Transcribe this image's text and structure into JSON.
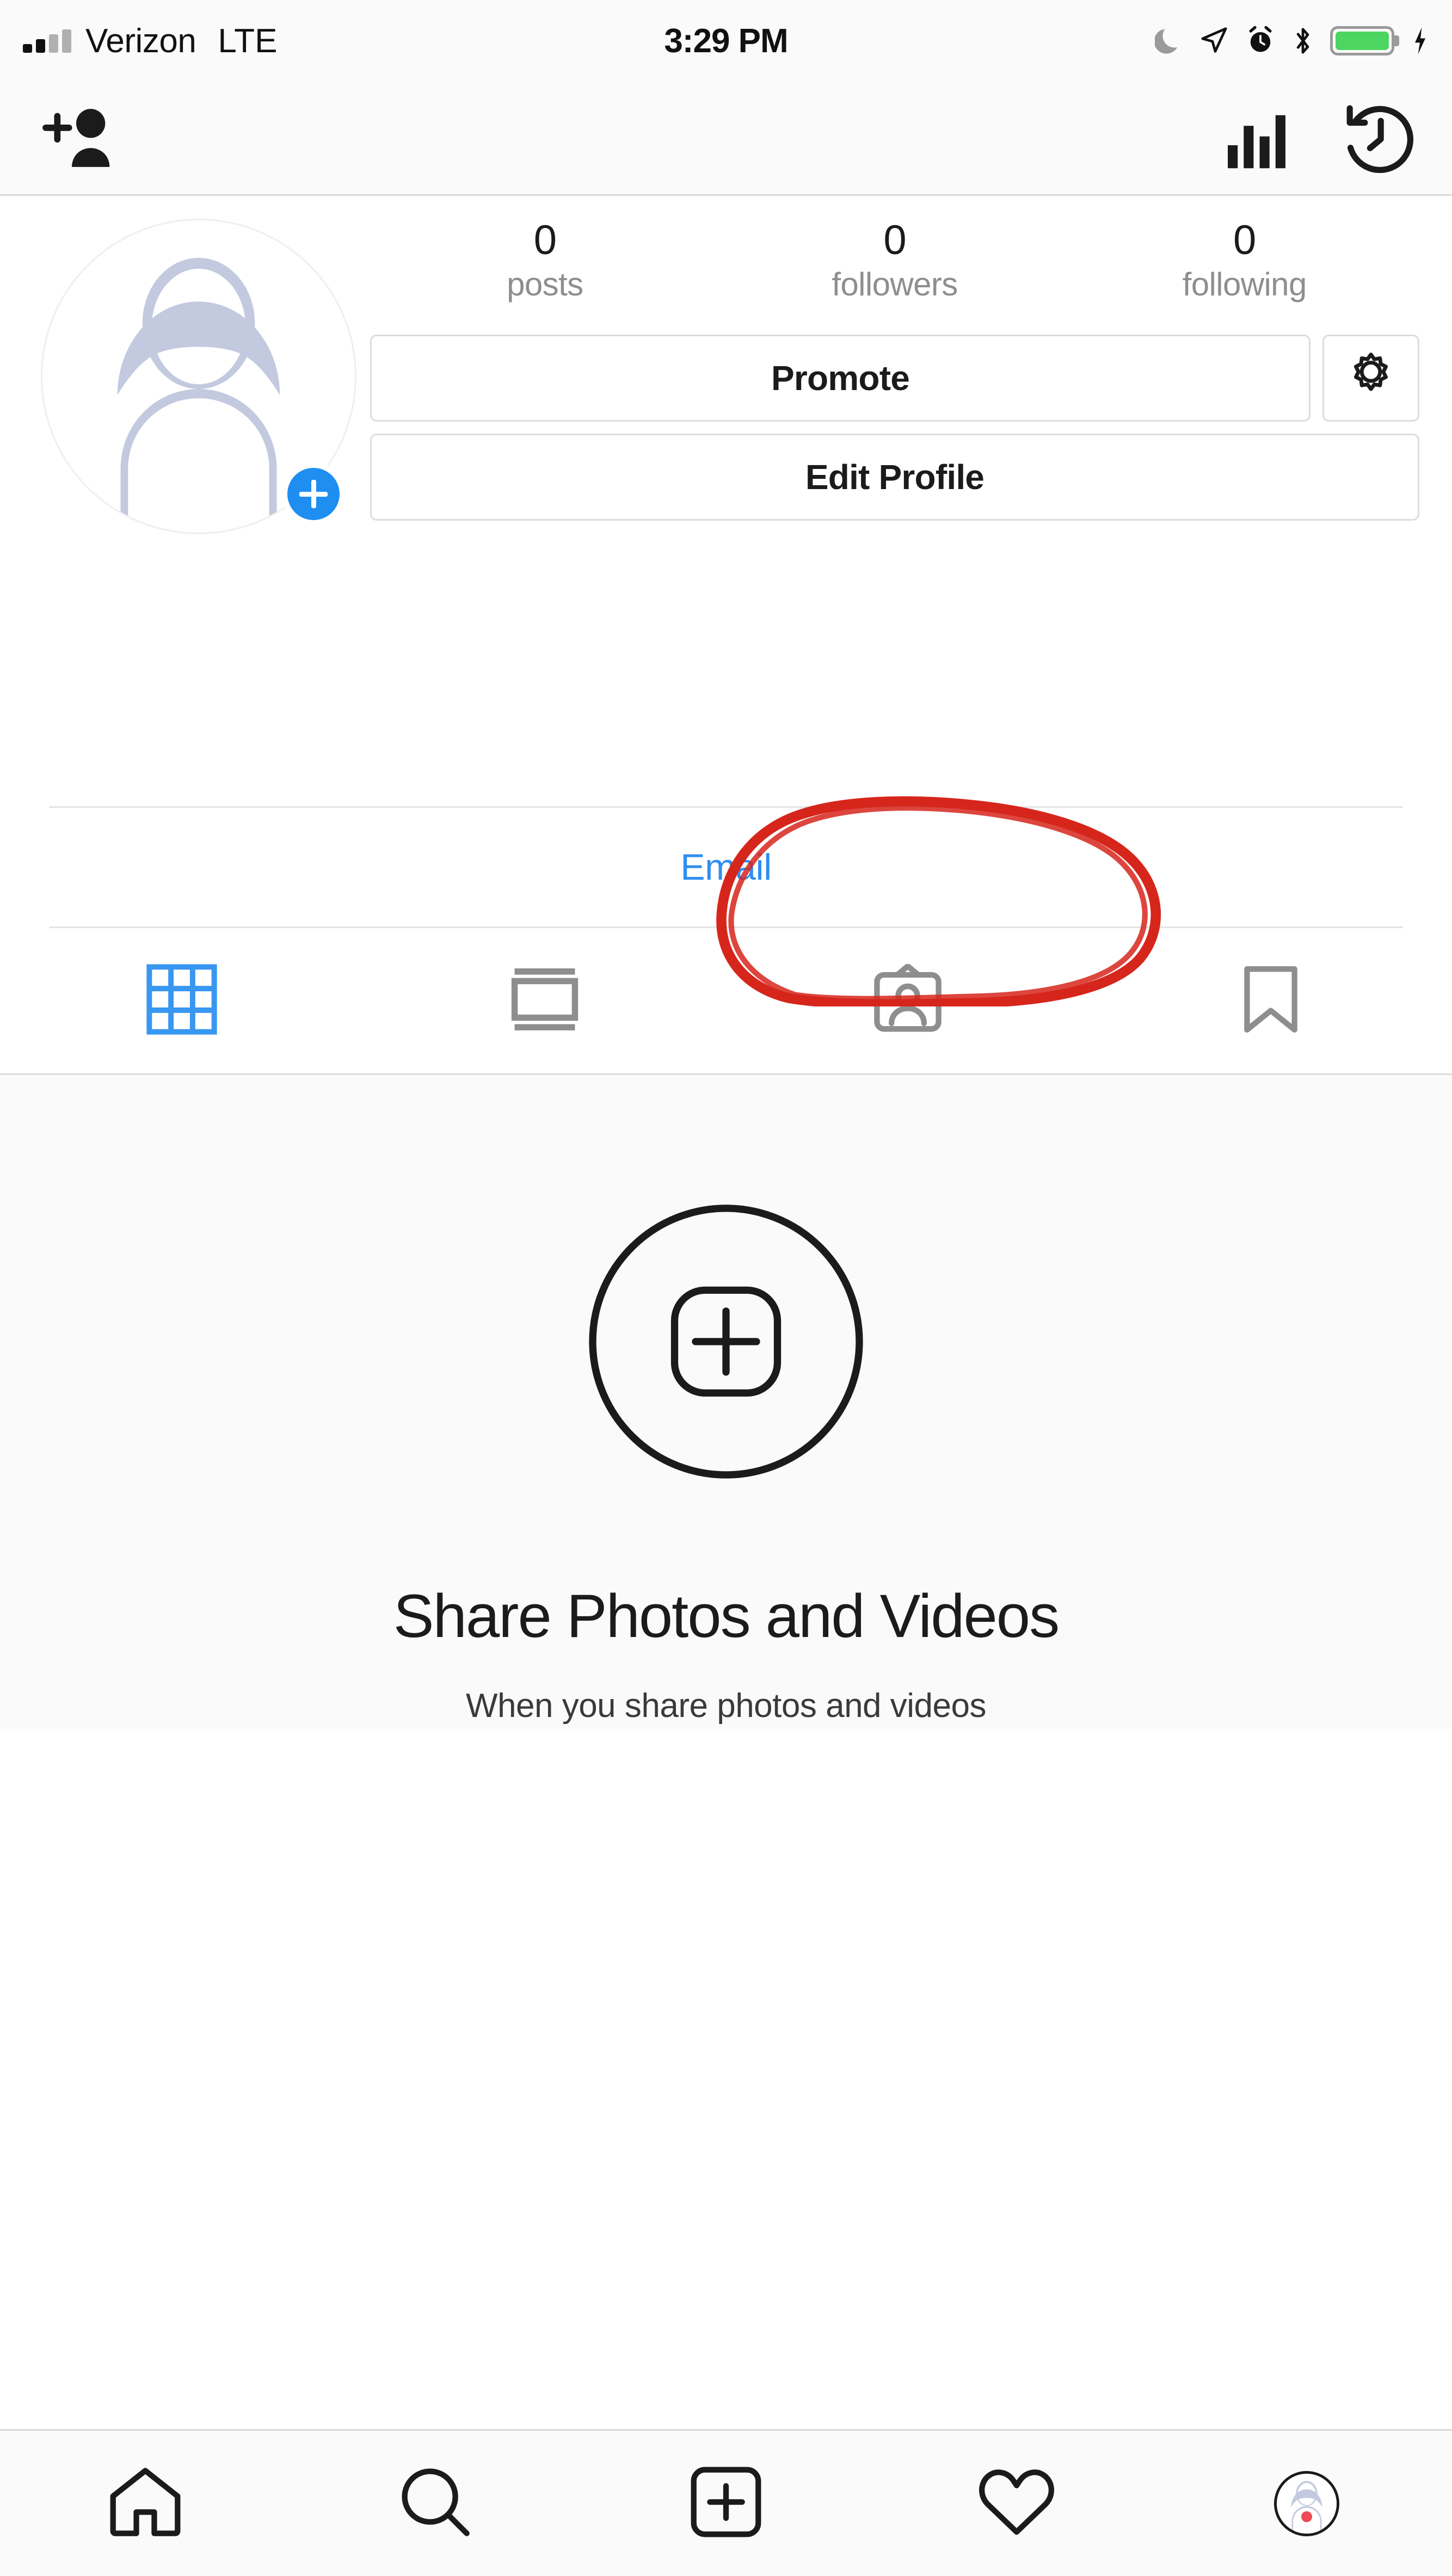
{
  "status_bar": {
    "carrier": "Verizon",
    "network": "LTE",
    "time": "3:29 PM",
    "icons": [
      "signal-bars-icon",
      "do-not-disturb-moon-icon",
      "location-arrow-icon",
      "alarm-clock-icon",
      "bluetooth-icon",
      "battery-icon",
      "charging-bolt-icon"
    ],
    "battery_level_percent": 100,
    "battery_color": "#4cd661"
  },
  "navbar": {
    "add_person_icon": "add-person-icon",
    "insights_icon": "insights-bar-chart-icon",
    "archive_icon": "archive-history-clock-icon"
  },
  "profile": {
    "avatar_alt": "default-avatar-placeholder",
    "add_story_badge": "+",
    "stats": [
      {
        "value": "0",
        "label": "posts"
      },
      {
        "value": "0",
        "label": "followers"
      },
      {
        "value": "0",
        "label": "following"
      }
    ],
    "buttons": {
      "promote": "Promote",
      "settings_icon": "gear-icon",
      "edit_profile": "Edit Profile"
    },
    "contact": {
      "email_label": "Email",
      "email_color": "#2f8ef0"
    }
  },
  "tabs": [
    {
      "name": "grid",
      "icon": "grid-icon",
      "active": true
    },
    {
      "name": "list",
      "icon": "list-feed-icon",
      "active": false
    },
    {
      "name": "tagged",
      "icon": "tagged-person-icon",
      "active": false
    },
    {
      "name": "saved",
      "icon": "bookmark-icon",
      "active": false
    }
  ],
  "empty_state": {
    "icon": "add-post-circle-icon",
    "title": "Share Photos\nand Videos",
    "subtitle": "When you share photos and videos"
  },
  "bottom_nav": [
    {
      "name": "home",
      "icon": "home-icon"
    },
    {
      "name": "search",
      "icon": "search-icon"
    },
    {
      "name": "add",
      "icon": "plus-square-icon"
    },
    {
      "name": "activity",
      "icon": "heart-icon"
    },
    {
      "name": "profile",
      "icon": "profile-avatar-icon",
      "badge": true
    }
  ],
  "annotation": {
    "type": "hand-drawn-ellipse",
    "color": "#d6261c",
    "target": "Edit Profile"
  }
}
